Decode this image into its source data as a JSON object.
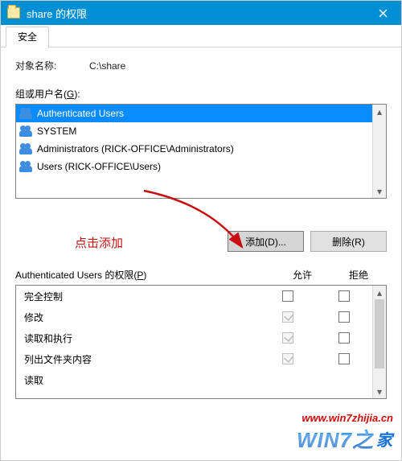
{
  "window": {
    "title": "share 的权限"
  },
  "tabs": {
    "security": "安全"
  },
  "object": {
    "label": "对象名称:",
    "value": "C:\\share"
  },
  "groups": {
    "label_pre": "组或用户名(",
    "hotkey": "G",
    "label_post": "):",
    "items": [
      {
        "name": "Authenticated Users",
        "selected": true
      },
      {
        "name": "SYSTEM",
        "selected": false
      },
      {
        "name": "Administrators (RICK-OFFICE\\Administrators)",
        "selected": false
      },
      {
        "name": "Users (RICK-OFFICE\\Users)",
        "selected": false
      }
    ]
  },
  "buttons": {
    "add": "添加(D)...",
    "remove": "删除(R)"
  },
  "hint": "点击添加",
  "permissions": {
    "header_pre": "Authenticated Users 的权限(",
    "header_hot": "P",
    "header_post": ")",
    "col_allow": "允许",
    "col_deny": "拒绝",
    "rows": [
      {
        "label": "完全控制",
        "allow": "empty",
        "deny": "empty"
      },
      {
        "label": "修改",
        "allow": "checked-disabled",
        "deny": "empty"
      },
      {
        "label": "读取和执行",
        "allow": "checked-disabled",
        "deny": "empty"
      },
      {
        "label": "列出文件夹内容",
        "allow": "checked-disabled",
        "deny": "empty"
      },
      {
        "label": "读取",
        "allow": "hidden",
        "deny": "hidden"
      }
    ]
  },
  "watermark": {
    "url": "www.win7zhijia.cn",
    "logo_main": "WIN7",
    "logo_sub": "之",
    "logo_house": "家"
  }
}
